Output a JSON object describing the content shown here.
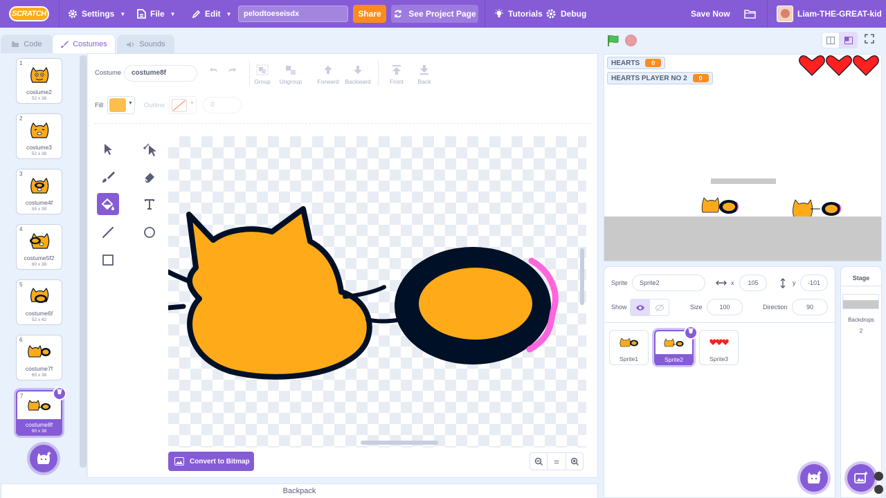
{
  "menubar": {
    "logo": "SCRATCH",
    "settings": "Settings",
    "file": "File",
    "edit": "Edit",
    "project_title": "pelodtoeseisdx",
    "share": "Share",
    "see_project_page": "See Project Page",
    "tutorials": "Tutorials",
    "debug": "Debug",
    "save_now": "Save Now",
    "username": "Liam-THE-GREAT-kid"
  },
  "tabs": {
    "code": "Code",
    "costumes": "Costumes",
    "sounds": "Sounds"
  },
  "costumes": [
    {
      "num": "1",
      "name": "costume2",
      "size": "52 x 38"
    },
    {
      "num": "2",
      "name": "costume3",
      "size": "52 x 38"
    },
    {
      "num": "3",
      "name": "costume4f",
      "size": "55 x 39"
    },
    {
      "num": "4",
      "name": "costume5f2",
      "size": "60 x 38"
    },
    {
      "num": "5",
      "name": "costume6f",
      "size": "52 x 42"
    },
    {
      "num": "6",
      "name": "costume7f",
      "size": "65 x 38"
    },
    {
      "num": "7",
      "name": "costume8f",
      "size": "90 x 38"
    }
  ],
  "paint": {
    "costume_label": "Costume",
    "costume_name": "costume8f",
    "group": "Group",
    "ungroup": "Ungroup",
    "forward": "Forward",
    "backward": "Backward",
    "front": "Front",
    "back": "Back",
    "fill_label": "Fill",
    "outline_label": "Outline",
    "outline_width": "0",
    "fill_color": "#ffbf4d",
    "convert_bitmap": "Convert to Bitmap",
    "zoom_reset": "="
  },
  "backpack": "Backpack",
  "stage": {
    "monitors": [
      {
        "label": "HEARTS",
        "value": "0"
      },
      {
        "label": "HEARTS PLAYER NO 2",
        "value": "0"
      }
    ]
  },
  "sprite_info": {
    "sprite_label": "Sprite",
    "sprite_name": "Sprite2",
    "x_label": "x",
    "x_value": "105",
    "y_label": "y",
    "y_value": "-101",
    "show_label": "Show",
    "size_label": "Size",
    "size_value": "100",
    "direction_label": "Direction",
    "direction_value": "90"
  },
  "sprites": [
    {
      "name": "Sprite1"
    },
    {
      "name": "Sprite2"
    },
    {
      "name": "Sprite3"
    }
  ],
  "stage_panel": {
    "title": "Stage",
    "backdrops_label": "Backdrops",
    "backdrops_count": "2"
  },
  "colors": {
    "accent": "#855cd6",
    "orange": "#ff8c1a",
    "cat_fill": "#ffab19",
    "dark": "#001026",
    "pink": "#ff66dd"
  }
}
